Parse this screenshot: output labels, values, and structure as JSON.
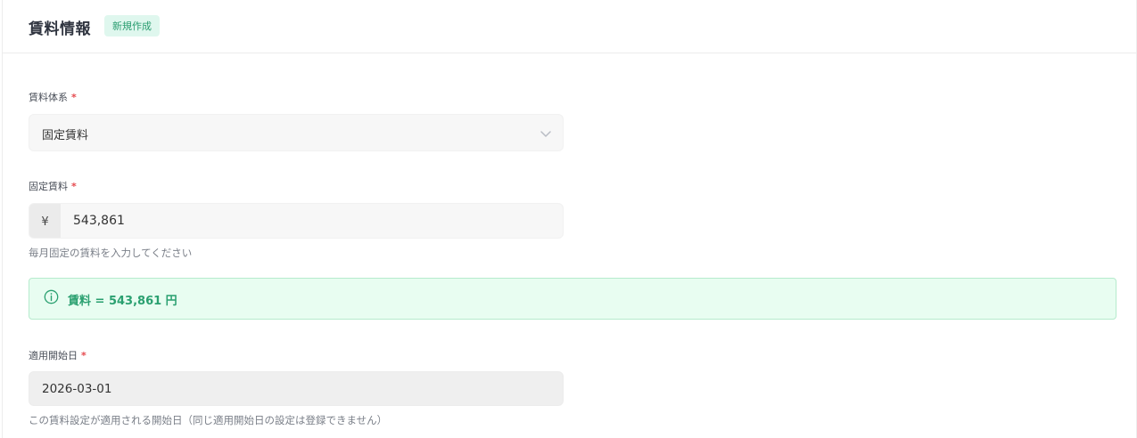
{
  "header": {
    "title": "賃料情報",
    "badge": "新規作成"
  },
  "rent_system": {
    "label": "賃料体系",
    "required_mark": "*",
    "selected": "固定賃料",
    "icon": "chevron-down-icon"
  },
  "fixed_rent": {
    "label": "固定賃料",
    "required_mark": "*",
    "currency_prefix": "¥",
    "value": "543,861",
    "help": "毎月固定の賃料を入力してください"
  },
  "summary": {
    "icon": "info-icon",
    "text": "賃料 = 543,861 円"
  },
  "start_date": {
    "label": "適用開始日",
    "required_mark": "*",
    "value": "2026-03-01",
    "help": "この賃料設定が適用される開始日（同じ適用開始日の設定は登録できません）"
  },
  "colors": {
    "badge_bg": "#dff7ee",
    "badge_text": "#2a9d70",
    "alert_bg": "#e8fdf1",
    "alert_text": "#2aa070",
    "required": "#e5484d"
  }
}
